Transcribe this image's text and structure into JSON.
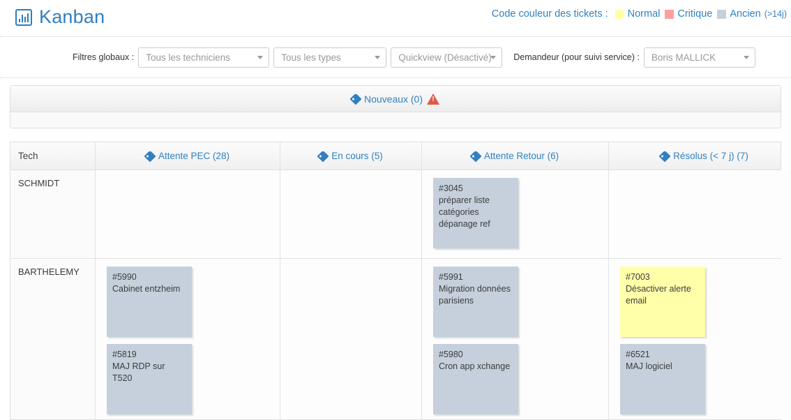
{
  "header": {
    "title": "Kanban",
    "brand_icon": "bar-chart-icon",
    "legend": {
      "label": "Code couleur des tickets :",
      "items": [
        {
          "text": "Normal",
          "color": "#ffffaa"
        },
        {
          "text": "Critique",
          "color": "#ffa0a0"
        },
        {
          "text": "Ancien ",
          "suffix": "(>14j)",
          "color": "#c5d0dc"
        }
      ]
    }
  },
  "filters": {
    "label": "Filtres globaux :",
    "technician": {
      "value": "Tous les techniciens"
    },
    "type": {
      "value": "Tous les types"
    },
    "quickview": {
      "value": "Quickview (Désactivé)"
    },
    "requester_label": "Demandeur (pour suivi service) :",
    "requester": {
      "value": "Boris MALLICK"
    }
  },
  "new_section": {
    "label": "Nouveaux (0)",
    "tag_icon": "tag-icon",
    "warning_icon": "warning-triangle-icon"
  },
  "board": {
    "columns": [
      {
        "key": "tech",
        "label": "Tech"
      },
      {
        "key": "pec",
        "label": "Attente PEC (28)"
      },
      {
        "key": "cours",
        "label": "En cours (5)"
      },
      {
        "key": "retour",
        "label": "Attente Retour (6)"
      },
      {
        "key": "res",
        "label": "Résolus (< 7 j) (7)"
      }
    ],
    "rows": [
      {
        "tech": "SCHMIDT",
        "pec": [],
        "cours": [],
        "retour": [
          {
            "id": "#3045",
            "title": "préparer liste catégories dépanage ref",
            "color": "grey"
          }
        ],
        "res": []
      },
      {
        "tech": "BARTHELEMY",
        "pec": [
          {
            "id": "#5990",
            "title": "Cabinet entzheim",
            "color": "grey"
          },
          {
            "id": "#5819",
            "title": "MAJ RDP sur T520",
            "color": "grey"
          }
        ],
        "cours": [],
        "retour": [
          {
            "id": "#5991",
            "title": "Migration données parisiens",
            "color": "grey"
          },
          {
            "id": "#5980",
            "title": "Cron app xchange",
            "color": "grey"
          }
        ],
        "res": [
          {
            "id": "#7003",
            "title": "Désactiver alerte email",
            "color": "yellow"
          },
          {
            "id": "#6521",
            "title": "MAJ logiciel",
            "color": "grey"
          }
        ]
      }
    ]
  }
}
